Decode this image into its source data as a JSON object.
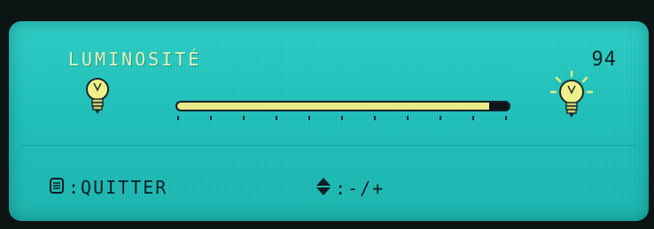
{
  "osd": {
    "title": "LUMINOSITÉ",
    "value": "94",
    "exit_label": ":QUITTER",
    "adjust_label": ":-/+",
    "brightness_level": 94,
    "brightness_max": 100,
    "icons": {
      "low": "bulb-low-icon",
      "high": "bulb-high-icon",
      "menu": "menu-button-icon",
      "updown": "up-down-arrows-icon"
    },
    "colors": {
      "panel": "#22c3bc",
      "slider_fill": "#e9ea88",
      "slider_bg": "#0e161a",
      "title": "#e3f0b8",
      "bulb": "#f0f08a"
    }
  }
}
